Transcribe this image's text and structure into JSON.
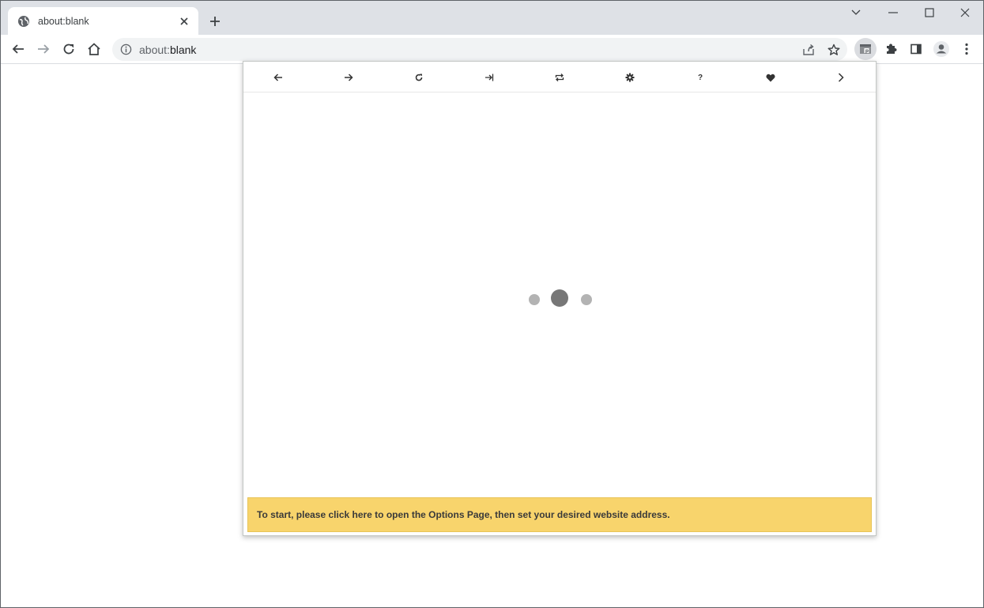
{
  "tab": {
    "title": "about:blank",
    "favicon": "globe-icon",
    "close_icon": "close-icon"
  },
  "window_controls": [
    "chevron-down-icon",
    "minimize-icon",
    "maximize-icon",
    "close-icon"
  ],
  "toolbar": {
    "url_host": "about:",
    "url_path": "blank",
    "icons": [
      "back-arrow-icon",
      "forward-arrow-icon",
      "reload-icon",
      "home-icon",
      "info-icon",
      "share-icon",
      "star-icon",
      "extension-icon",
      "puzzle-icon",
      "side-panel-icon",
      "profile-icon",
      "more-vert-icon"
    ]
  },
  "popup": {
    "nav_icons": [
      "back-arrow-icon",
      "forward-arrow-icon",
      "reload-icon",
      "login-arrow-icon",
      "repeat-icon",
      "gear-icon",
      "help-icon",
      "heart-icon",
      "chevron-right-icon"
    ],
    "help_label": "?",
    "notice_text": "To start, please click here to open the Options Page, then set your desired website address.",
    "colors": {
      "notice_bg": "#f8d46c",
      "loader_dot_small": "#b3b3b3",
      "loader_dot_large": "#777777"
    }
  }
}
